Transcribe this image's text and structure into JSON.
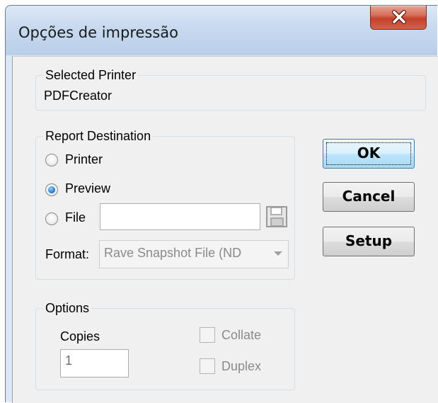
{
  "window": {
    "title": "Opções de impressão"
  },
  "selected_printer": {
    "legend": "Selected Printer",
    "value": "PDFCreator"
  },
  "report_destination": {
    "legend": "Report Destination",
    "printer_label": "Printer",
    "preview_label": "Preview",
    "file_label": "File",
    "file_value": "",
    "format_label": "Format:",
    "format_value": "Rave Snapshot File (ND",
    "selected": "Preview"
  },
  "options": {
    "legend": "Options",
    "copies_label": "Copies",
    "copies_value": "1",
    "collate_label": "Collate",
    "collate_checked": false,
    "duplex_label": "Duplex",
    "duplex_checked": false
  },
  "buttons": {
    "ok": "OK",
    "cancel": "Cancel",
    "setup": "Setup"
  },
  "icons": {
    "close": "close-icon",
    "save": "floppy-disk-icon"
  }
}
